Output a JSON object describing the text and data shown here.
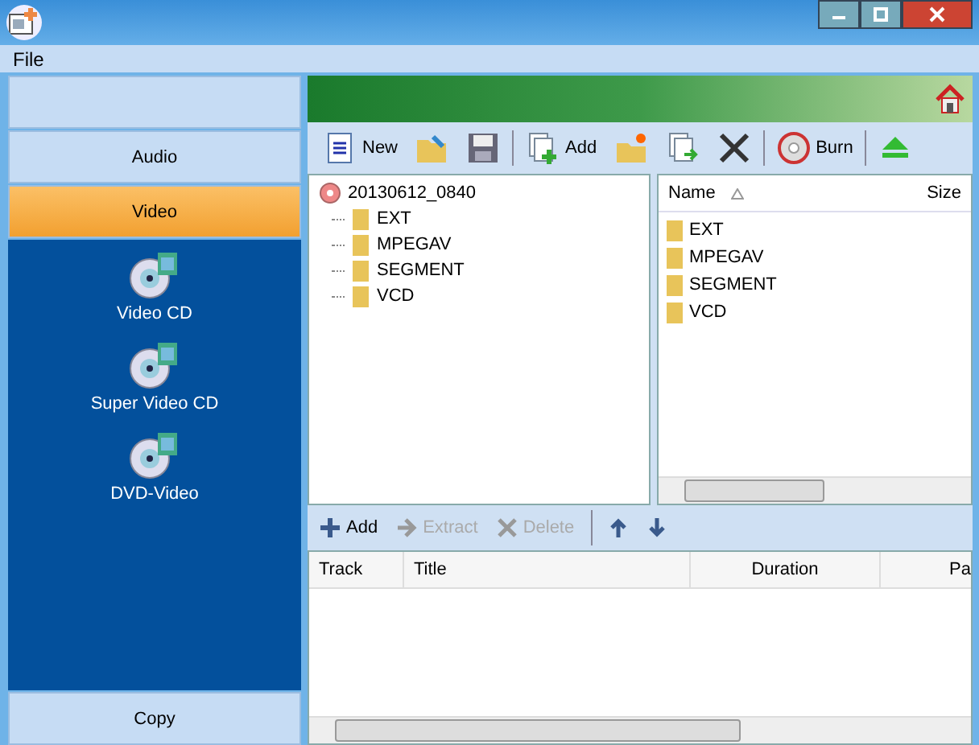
{
  "menu": [
    {
      "label": "File"
    }
  ],
  "sidebar": {
    "categories": [
      {
        "label": "Audio",
        "selected": false
      },
      {
        "label": "Video",
        "selected": true
      }
    ],
    "items": [
      {
        "label": "Video CD"
      },
      {
        "label": "Super Video CD"
      },
      {
        "label": "DVD-Video"
      }
    ],
    "footer_categories": [
      {
        "label": "Copy",
        "selected": false
      }
    ]
  },
  "toolbar": [
    {
      "kind": "new",
      "label": "New"
    },
    {
      "kind": "open"
    },
    {
      "kind": "save"
    },
    {
      "kind": "sep"
    },
    {
      "kind": "add",
      "label": "Add"
    },
    {
      "kind": "newfolder"
    },
    {
      "kind": "import"
    },
    {
      "kind": "delete"
    },
    {
      "kind": "sep"
    },
    {
      "kind": "burn",
      "label": "Burn"
    },
    {
      "kind": "sep"
    },
    {
      "kind": "eject"
    }
  ],
  "tree": {
    "label": "20130612_0840",
    "children": [
      {
        "label": "EXT"
      },
      {
        "label": "MPEGAV"
      },
      {
        "label": "SEGMENT"
      },
      {
        "label": "VCD"
      }
    ]
  },
  "file_list": {
    "columns": [
      "Name",
      "Size"
    ],
    "rows": [
      {
        "name": "EXT"
      },
      {
        "name": "MPEGAV"
      },
      {
        "name": "SEGMENT"
      },
      {
        "name": "VCD"
      }
    ]
  },
  "track_toolbar": [
    {
      "kind": "add",
      "label": "Add",
      "disabled": false
    },
    {
      "kind": "extract",
      "label": "Extract",
      "disabled": true
    },
    {
      "kind": "delete",
      "label": "Delete",
      "disabled": true
    },
    {
      "kind": "sep"
    },
    {
      "kind": "up",
      "disabled": false
    },
    {
      "kind": "down",
      "disabled": false
    }
  ],
  "track_table": {
    "columns": [
      "Track",
      "Title",
      "Duration",
      "Pa"
    ]
  }
}
